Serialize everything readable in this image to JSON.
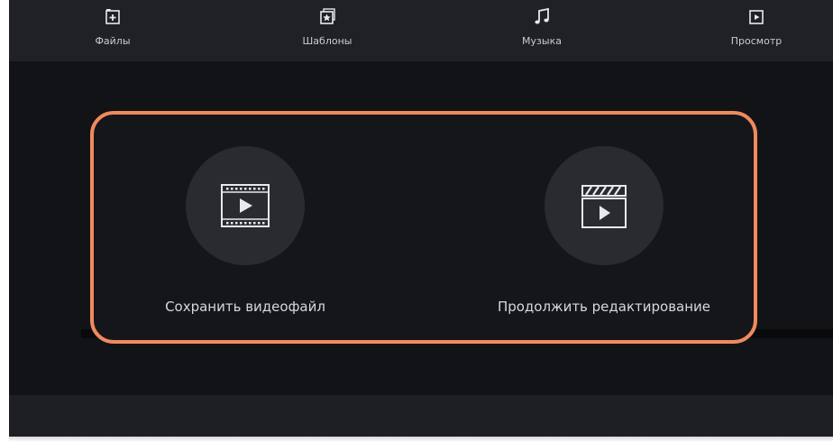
{
  "toolbar": {
    "items": [
      {
        "label": "Файлы",
        "icon": "file-add-icon"
      },
      {
        "label": "Шаблоны",
        "icon": "template-star-icon"
      },
      {
        "label": "Музыка",
        "icon": "music-note-icon"
      },
      {
        "label": "Просмотр",
        "icon": "play-preview-icon"
      }
    ]
  },
  "dialog": {
    "options": [
      {
        "label": "Сохранить видеофайл",
        "icon": "video-file-icon"
      },
      {
        "label": "Продолжить редактирование",
        "icon": "clapperboard-icon"
      }
    ]
  },
  "colors": {
    "highlight": "#f08a5d",
    "background": "#16171b",
    "circle": "#2a2b31",
    "text": "#d6d8de"
  }
}
